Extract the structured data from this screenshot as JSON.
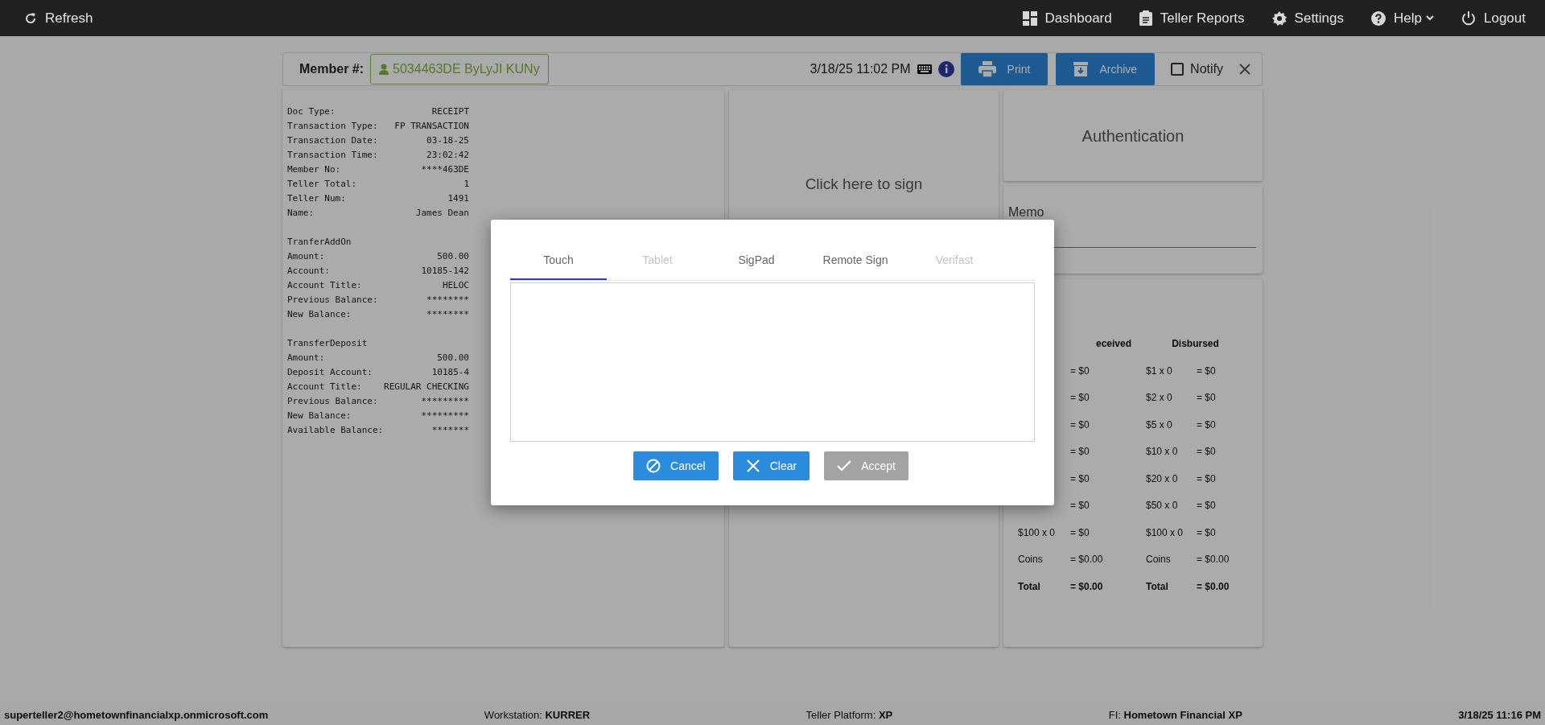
{
  "navbar": {
    "left": [
      {
        "kind": "refresh",
        "label": "Refresh"
      }
    ],
    "right": [
      {
        "kind": "dashboard",
        "label": "Dashboard",
        "dropdown": false
      },
      {
        "kind": "reports",
        "label": "Teller Reports",
        "dropdown": false
      },
      {
        "kind": "settings",
        "label": "Settings",
        "dropdown": false
      },
      {
        "kind": "help",
        "label": "Help",
        "dropdown": true
      },
      {
        "kind": "logout",
        "label": "Logout",
        "dropdown": false
      }
    ]
  },
  "member_bar": {
    "label": "Member #:",
    "member": "5034463DE ByLyJI KUNy",
    "datetime": "3/18/25 11:02 PM",
    "print": "Print",
    "archive": "Archive",
    "notify": {
      "label": "Notify",
      "checked": false
    }
  },
  "receipt": [
    [
      {
        "label": "Doc Type:",
        "value": "RECEIPT"
      },
      {
        "label": "Transaction Type:",
        "value": "FP TRANSACTION"
      },
      {
        "label": "Transaction Date:",
        "value": "03-18-25"
      },
      {
        "label": "Transaction Time:",
        "value": "23:02:42"
      },
      {
        "label": "Member No:",
        "value": "****463DE"
      },
      {
        "label": "Teller Total:",
        "value": "1"
      },
      {
        "label": "Teller Num:",
        "value": "1491"
      },
      {
        "label": "Name:",
        "value": "James Dean"
      }
    ],
    [
      {
        "label": "TranferAddOn"
      },
      {
        "label": "Amount:",
        "value": "500.00"
      },
      {
        "label": "Account:",
        "value": "10185-142"
      },
      {
        "label": "Account Title:",
        "value": "HELOC"
      },
      {
        "label": "Previous Balance:",
        "value": "********"
      },
      {
        "label": "New Balance:",
        "value": "********"
      }
    ],
    [
      {
        "label": "TransferDeposit"
      },
      {
        "label": "Amount:",
        "value": "500.00"
      },
      {
        "label": "Deposit Account:",
        "value": "10185-4"
      },
      {
        "label": "Account Title:",
        "value": "REGULAR CHECKING"
      },
      {
        "label": "Previous Balance:",
        "value": "*********"
      },
      {
        "label": "New Balance:",
        "value": "*********"
      },
      {
        "label": "Available Balance:",
        "value": "*******"
      }
    ]
  ],
  "signature": {
    "prompt": "Click here to sign"
  },
  "authentication": {
    "title": "Authentication"
  },
  "memo": {
    "label": "Memo"
  },
  "cash": {
    "received": {
      "title": "eceived",
      "rows": [
        {
          "value": "= $0"
        },
        {
          "value": "= $0"
        },
        {
          "value": "= $0"
        },
        {
          "value": "= $0"
        },
        {
          "value": "= $0"
        },
        {
          "value": "= $0"
        },
        {
          "label": "$100 x 0",
          "value": "= $0"
        },
        {
          "label": "Coins",
          "value": "= $0.00"
        },
        {
          "label": "Total",
          "value": "= $0.00",
          "total": true
        }
      ]
    },
    "disbursed": {
      "title": "Disbursed",
      "rows": [
        {
          "label": "$1 x 0",
          "value": "= $0"
        },
        {
          "label": "$2 x 0",
          "value": "= $0"
        },
        {
          "label": "$5 x 0",
          "value": "= $0"
        },
        {
          "label": "$10 x 0",
          "value": "= $0"
        },
        {
          "label": "$20 x 0",
          "value": "= $0"
        },
        {
          "label": "$50 x 0",
          "value": "= $0"
        },
        {
          "label": "$100 x 0",
          "value": "= $0"
        },
        {
          "label": "Coins",
          "value": "= $0.00"
        },
        {
          "label": "Total",
          "value": "= $0.00",
          "total": true
        }
      ]
    }
  },
  "modal": {
    "tabs": [
      {
        "label": "Touch",
        "selected": true,
        "disabled": false
      },
      {
        "label": "Tablet",
        "selected": false,
        "disabled": true
      },
      {
        "label": "SigPad",
        "selected": false,
        "disabled": false
      },
      {
        "label": "Remote Sign",
        "selected": false,
        "disabled": false
      },
      {
        "label": "Verifast",
        "selected": false,
        "disabled": true
      }
    ],
    "buttons": [
      {
        "kind": "cancel",
        "label": "Cancel",
        "disabled": false
      },
      {
        "kind": "clear",
        "label": "Clear",
        "disabled": false
      },
      {
        "kind": "accept",
        "label": "Accept",
        "disabled": true
      }
    ]
  },
  "status_bar": {
    "user": "superteller2@hometownfinancialxp.onmicrosoft.com",
    "items": [
      "Workstation: **KURRER**",
      "Teller Platform: **XP**",
      "FI: **Hometown Financial XP**"
    ],
    "datetime": "3/18/25 11:16 PM"
  }
}
